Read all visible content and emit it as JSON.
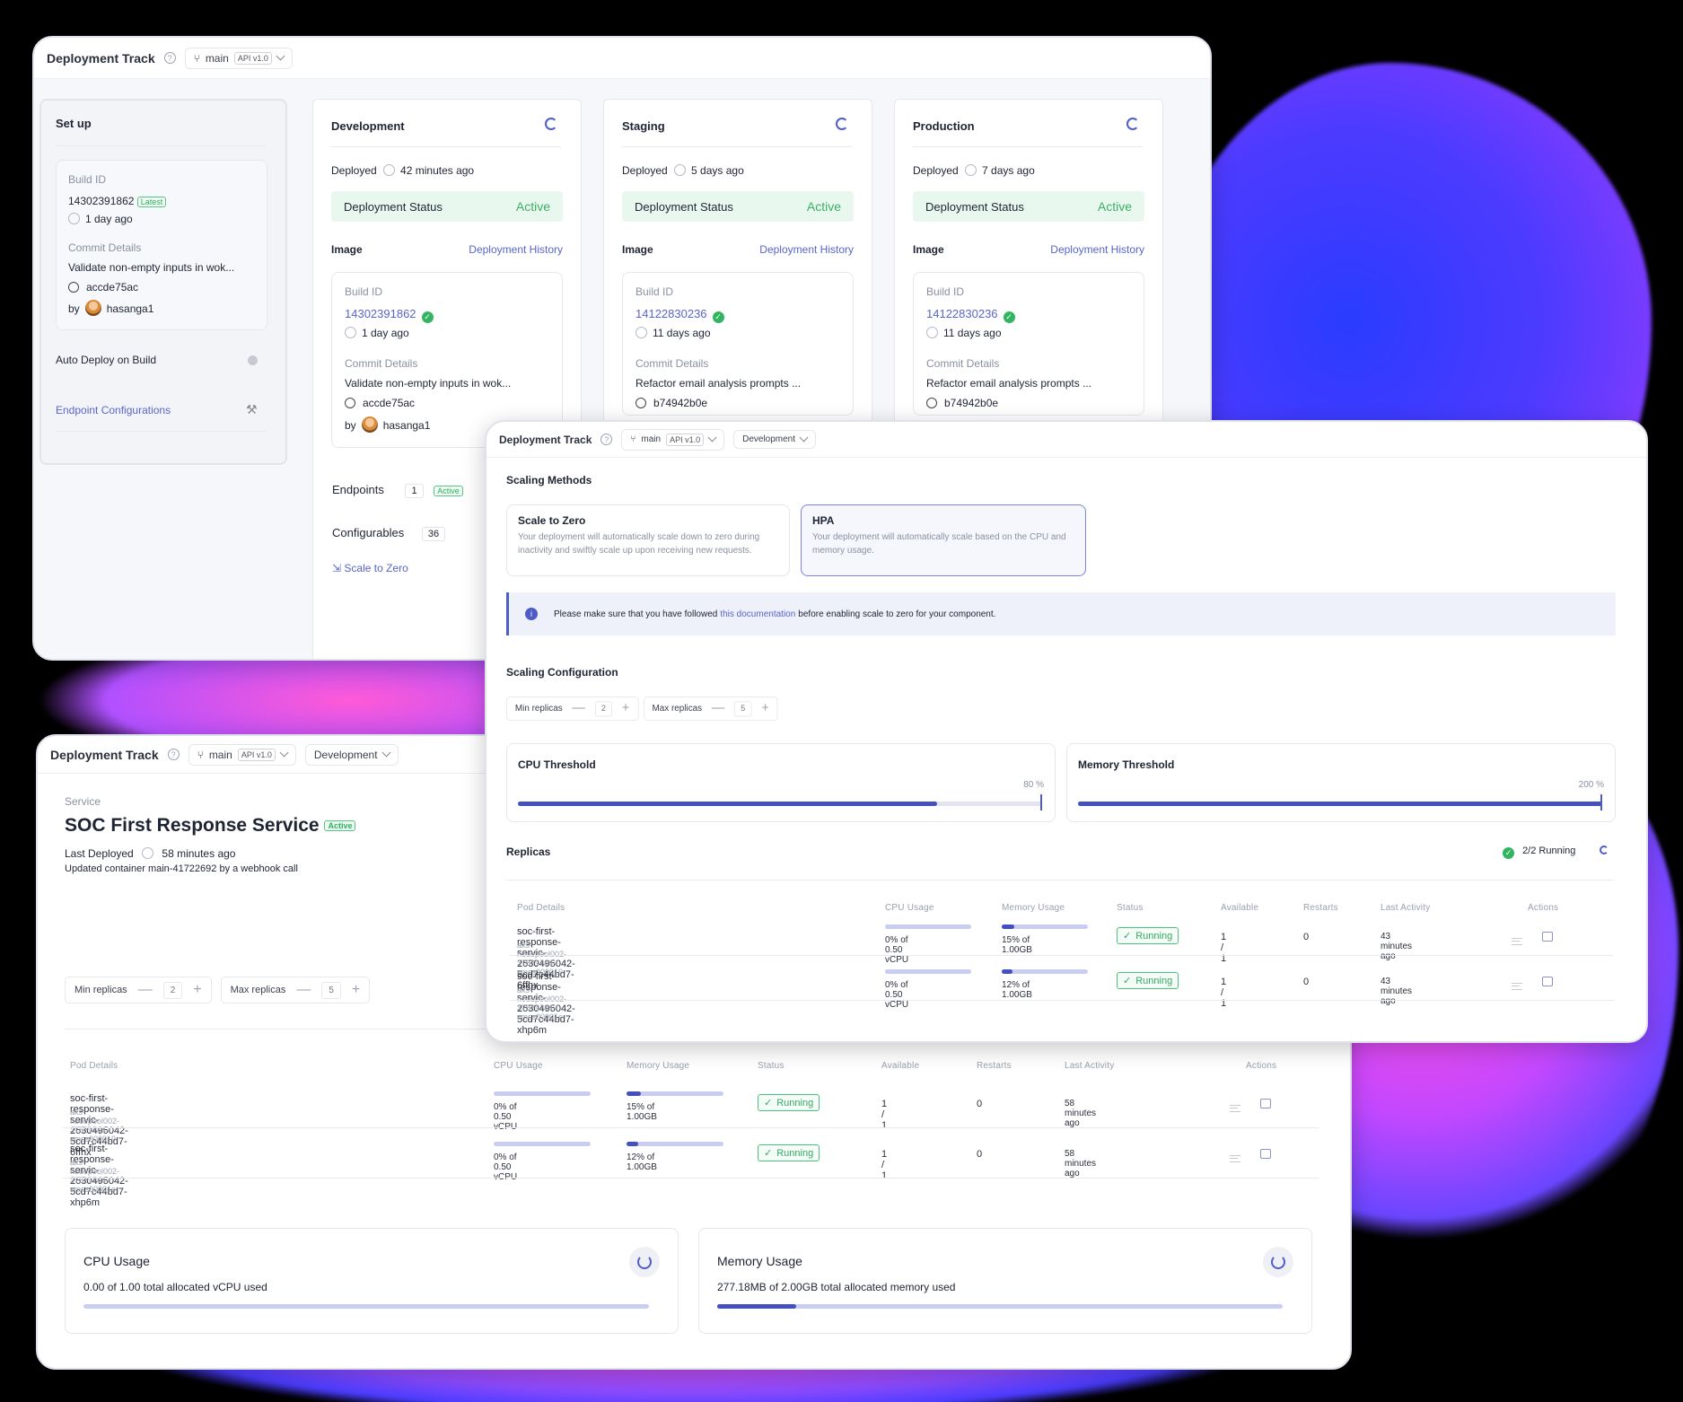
{
  "colors": {
    "accent": "#4e5cc8",
    "success": "#32b561",
    "bg": "#000000"
  },
  "win1": {
    "title": "Deployment Track",
    "branch": "main",
    "api": "API v1.0",
    "setup": {
      "heading": "Set up",
      "build_id_label": "Build ID",
      "build_id": "14302391862",
      "latest": "Latest",
      "build_time": "1 day ago",
      "commit_label": "Commit Details",
      "commit_msg": "Validate non-empty inputs in wok...",
      "commit_hash": "accde75ac",
      "by": "by",
      "author": "hasanga1",
      "auto_deploy": "Auto Deploy on Build",
      "endpoint_conf": "Endpoint Configurations"
    },
    "envs": [
      {
        "name": "Development",
        "deployed": "Deployed",
        "deployed_ago": "42 minutes ago",
        "status_label": "Deployment Status",
        "status": "Active",
        "image": "Image",
        "history": "Deployment History",
        "build_id_label": "Build ID",
        "build_id": "14302391862",
        "build_time": "1 day ago",
        "commit_label": "Commit Details",
        "commit_msg": "Validate non-empty inputs in wok...",
        "commit_hash": "accde75ac",
        "by": "by",
        "author": "hasanga1"
      },
      {
        "name": "Staging",
        "deployed": "Deployed",
        "deployed_ago": "5 days ago",
        "status_label": "Deployment Status",
        "status": "Active",
        "image": "Image",
        "history": "Deployment History",
        "build_id_label": "Build ID",
        "build_id": "14122830236",
        "build_time": "11 days ago",
        "commit_label": "Commit Details",
        "commit_msg": "Refactor email analysis prompts ...",
        "commit_hash": "b74942b0e"
      },
      {
        "name": "Production",
        "deployed": "Deployed",
        "deployed_ago": "7 days ago",
        "status_label": "Deployment Status",
        "status": "Active",
        "image": "Image",
        "history": "Deployment History",
        "build_id_label": "Build ID",
        "build_id": "14122830236",
        "build_time": "11 days ago",
        "commit_label": "Commit Details",
        "commit_msg": "Refactor email analysis prompts ...",
        "commit_hash": "b74942b0e"
      }
    ],
    "endpoints_label": "Endpoints",
    "endpoints_count": "1",
    "endpoints_status": "Active",
    "configurables_label": "Configurables",
    "configurables_count": "36",
    "scale_to_zero": "Scale to Zero"
  },
  "win2": {
    "title": "Deployment Track",
    "branch": "main",
    "api": "API v1.0",
    "env": "Development",
    "service_label": "Service",
    "service_name": "SOC First Response Service",
    "service_status": "Active",
    "last_deployed": "Last Deployed",
    "last_deployed_ago": "58 minutes ago",
    "update_note": "Updated container main-41722692 by a webhook call",
    "min_label": "Min replicas",
    "min_val": "2",
    "max_label": "Max replicas",
    "max_val": "5",
    "headers": [
      "Pod Details",
      "CPU Usage",
      "Memory Usage",
      "Status",
      "Available",
      "Restarts",
      "Last Activity",
      "Actions"
    ],
    "rows": [
      {
        "pod": "soc-first-response-servic-2630495042-5cd7c44bd7-6ffhx",
        "node": "aks-nodepool002-37529744-vmss000019",
        "cpu": "0% of 0.50 vCPU",
        "cpu_frac": 0,
        "mem": "15% of 1.00GB",
        "mem_frac": 0.15,
        "status": "Running",
        "available": "1 / 1",
        "restarts": "0",
        "activity": "58 minutes ago"
      },
      {
        "pod": "soc-first-response-servic-2630495042-5cd7c44bd7-xhp6m",
        "node": "aks-nodepool002-37529744-vmss00001e",
        "cpu": "0% of 0.50 vCPU",
        "cpu_frac": 0,
        "mem": "12% of 1.00GB",
        "mem_frac": 0.12,
        "status": "Running",
        "available": "1 / 1",
        "restarts": "0",
        "activity": "58 minutes ago"
      }
    ],
    "cpu_card": {
      "title": "CPU Usage",
      "text": "0.00 of 1.00 total allocated vCPU used",
      "frac": 0.0
    },
    "mem_card": {
      "title": "Memory Usage",
      "text": "277.18MB of 2.00GB total allocated memory used",
      "frac": 0.14
    }
  },
  "win3": {
    "title": "Deployment Track",
    "branch": "main",
    "api": "API v1.0",
    "env": "Development",
    "scaling_methods": "Scaling Methods",
    "stz_title": "Scale to Zero",
    "stz_desc": "Your deployment will automatically scale down to zero during inactivity and swiftly scale up upon receiving new requests.",
    "hpa_title": "HPA",
    "hpa_desc": "Your deployment will automatically scale based on the CPU and memory usage.",
    "info_pre": "Please make sure that you have followed ",
    "info_link": "this documentation",
    "info_post": " before enabling scale to zero for your component.",
    "scaling_conf": "Scaling Configuration",
    "min_label": "Min replicas",
    "min_val": "2",
    "max_label": "Max replicas",
    "max_val": "5",
    "cpu_threshold": "CPU Threshold",
    "cpu_val": "80 %",
    "cpu_frac": 0.8,
    "mem_threshold": "Memory Threshold",
    "mem_val": "200 %",
    "mem_frac": 1.0,
    "replicas": "Replicas",
    "running": "2/2 Running",
    "headers": [
      "Pod Details",
      "CPU Usage",
      "Memory Usage",
      "Status",
      "Available",
      "Restarts",
      "Last Activity",
      "Actions"
    ],
    "rows": [
      {
        "pod": "soc-first-response-servic-2630495042-5cd7c44bd7-6ffhx",
        "node": "aks-nodepool002-37529744-vmss000019",
        "cpu": "0% of 0.50 vCPU",
        "cpu_frac": 0,
        "mem": "15% of 1.00GB",
        "mem_frac": 0.15,
        "status": "Running",
        "available": "1 / 1",
        "restarts": "0",
        "activity": "43 minutes ago"
      },
      {
        "pod": "soc-first-response-servic-2630495042-5cd7c44bd7-xhp6m",
        "node": "aks-nodepool002-37529744-vmss00001e",
        "cpu": "0% of 0.50 vCPU",
        "cpu_frac": 0,
        "mem": "12% of 1.00GB",
        "mem_frac": 0.12,
        "status": "Running",
        "available": "1 / 1",
        "restarts": "0",
        "activity": "43 minutes ago"
      }
    ]
  }
}
